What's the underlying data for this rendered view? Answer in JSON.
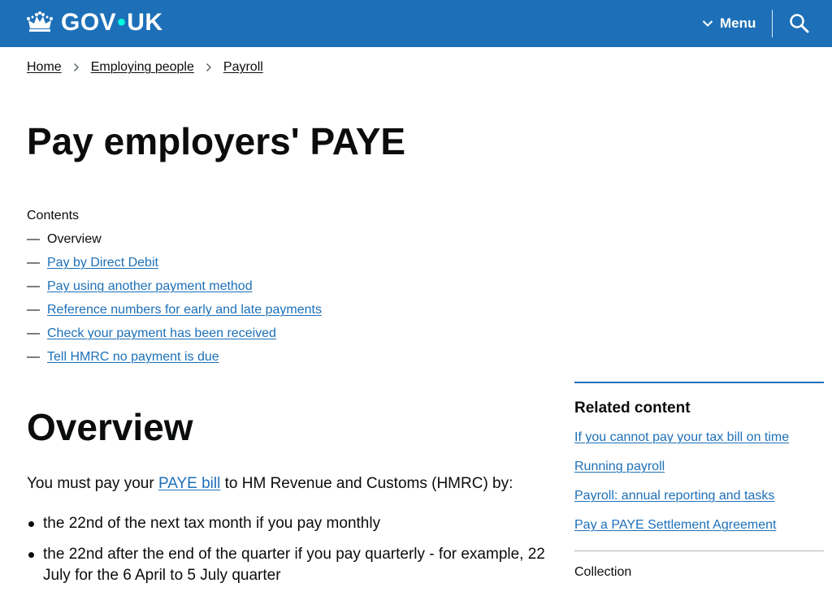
{
  "header": {
    "logo_text_left": "GOV",
    "logo_dot": "•",
    "logo_text_right": "UK",
    "menu_label": "Menu",
    "brand_color": "#1d70b8",
    "icons": [
      "crown-icon",
      "chevron-down-icon",
      "search-icon"
    ]
  },
  "breadcrumb": [
    {
      "label": "Home"
    },
    {
      "label": "Employing people"
    },
    {
      "label": "Payroll"
    }
  ],
  "page_title": "Pay employers' PAYE",
  "contents": {
    "label": "Contents",
    "dash": "—",
    "items": [
      {
        "label": "Overview",
        "current": true
      },
      {
        "label": "Pay by Direct Debit"
      },
      {
        "label": "Pay using another payment method"
      },
      {
        "label": "Reference numbers for early and late payments"
      },
      {
        "label": "Check your payment has been received"
      },
      {
        "label": "Tell HMRC no payment is due"
      }
    ]
  },
  "overview": {
    "heading": "Overview",
    "intro_before": "You must pay your ",
    "intro_link": "PAYE bill",
    "intro_after": " to HM Revenue and Customs (HMRC) by:",
    "bullets": [
      "the 22nd of the next tax month if you pay monthly",
      "the 22nd after the end of the quarter if you pay quarterly - for example, 22 July for the 6 April to 5 July quarter"
    ]
  },
  "sidebar": {
    "related_title": "Related content",
    "links": [
      "If you cannot pay your tax bill on time",
      "Running payroll",
      "Payroll: annual reporting and tasks",
      "Pay a PAYE Settlement Agreement"
    ],
    "collection_label": "Collection"
  }
}
